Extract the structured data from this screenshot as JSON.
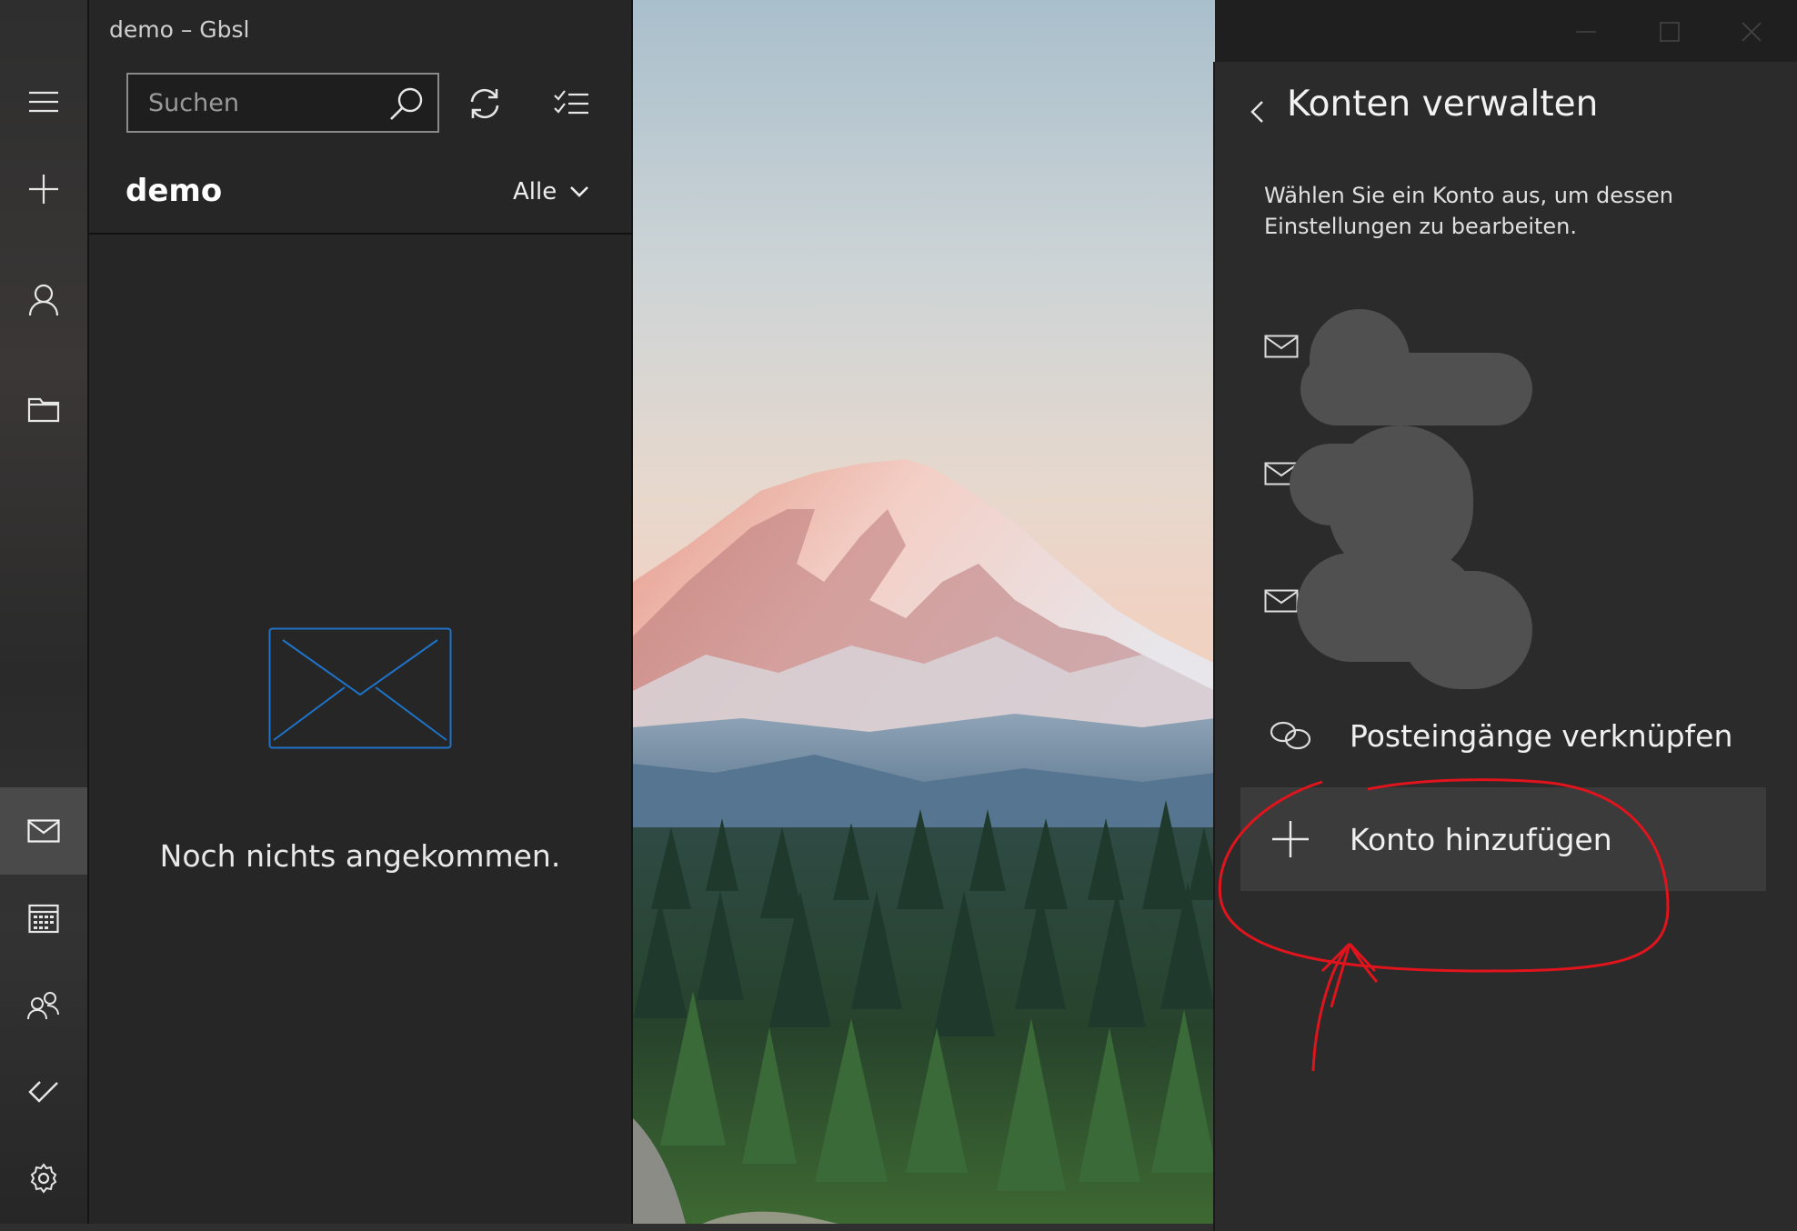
{
  "window": {
    "title": "demo – Gbsl",
    "controls": [
      "minimize-icon",
      "maximize-icon",
      "close-icon"
    ]
  },
  "nav_rail": {
    "items": [
      {
        "icon": "hamburger-menu-icon"
      },
      {
        "icon": "new-mail-icon"
      },
      {
        "icon": "accounts-icon"
      },
      {
        "icon": "folders-icon"
      },
      {
        "icon": "mail-icon",
        "active": true
      },
      {
        "icon": "calendar-icon"
      },
      {
        "icon": "people-icon"
      },
      {
        "icon": "todo-icon"
      },
      {
        "icon": "settings-icon"
      }
    ]
  },
  "message_pane": {
    "search": {
      "placeholder": "Suchen",
      "value": ""
    },
    "folder_title": "demo",
    "filter": {
      "selected": "Alle"
    },
    "empty_state": "Noch nichts angekommen."
  },
  "flyout": {
    "title": "Konten verwalten",
    "description": "Wählen Sie ein Konto aus, um dessen Einstellungen zu bearbeiten.",
    "accounts": [
      {
        "icon": "mail-icon",
        "redacted": true
      },
      {
        "icon": "mail-icon",
        "redacted": true
      },
      {
        "icon": "mail-icon",
        "redacted": true
      }
    ],
    "link_inboxes": "Posteingänge verknüpfen",
    "add_account": "Konto hinzufügen"
  },
  "colors": {
    "accent": "#0078d4",
    "annotation": "#e0141c",
    "flyout_bg": "#2b2b2b",
    "pane_bg": "#262626"
  }
}
